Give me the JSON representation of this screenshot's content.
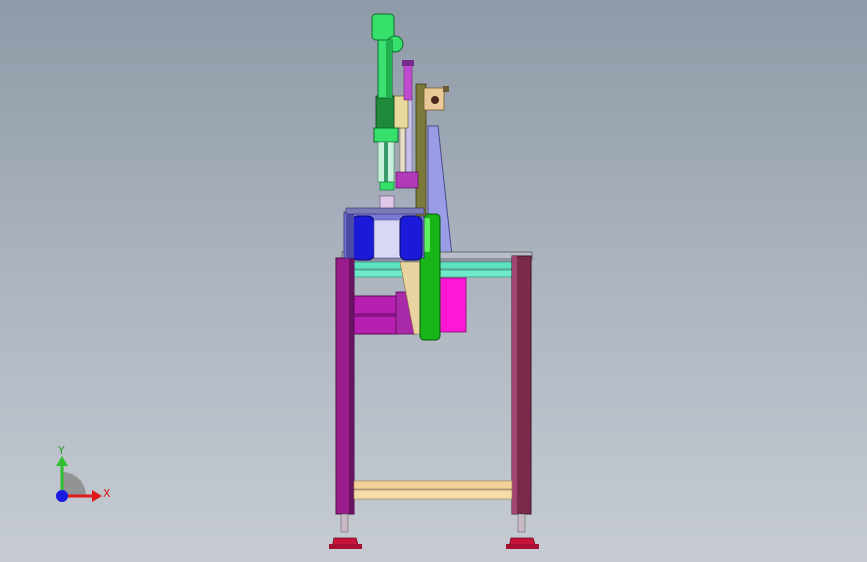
{
  "triad": {
    "y_label": "Y",
    "x_label": "X",
    "colors": {
      "y_axis": "#2fbf2f",
      "x_axis": "#e01a1a",
      "z_axis": "#1a1ae0",
      "plane": "#8a8a8a"
    }
  },
  "model_colors": {
    "cylinder_green": "#35e06b",
    "cylinder_dark_green": "#1e8a3a",
    "frame_purple": "#9a1c8c",
    "frame_maroon": "#7a2a4a",
    "motor_purple": "#b61fb0",
    "blue_drum": "#1a1ad8",
    "green_wheel": "#17b517",
    "magenta_block": "#ff17d6",
    "cyan_rail": "#5fe0c0",
    "lavender_plate": "#9a9ae8",
    "tan_bar": "#f3d29a",
    "red_foot": "#c8143c",
    "olive_bracket": "#7c7a3a"
  }
}
